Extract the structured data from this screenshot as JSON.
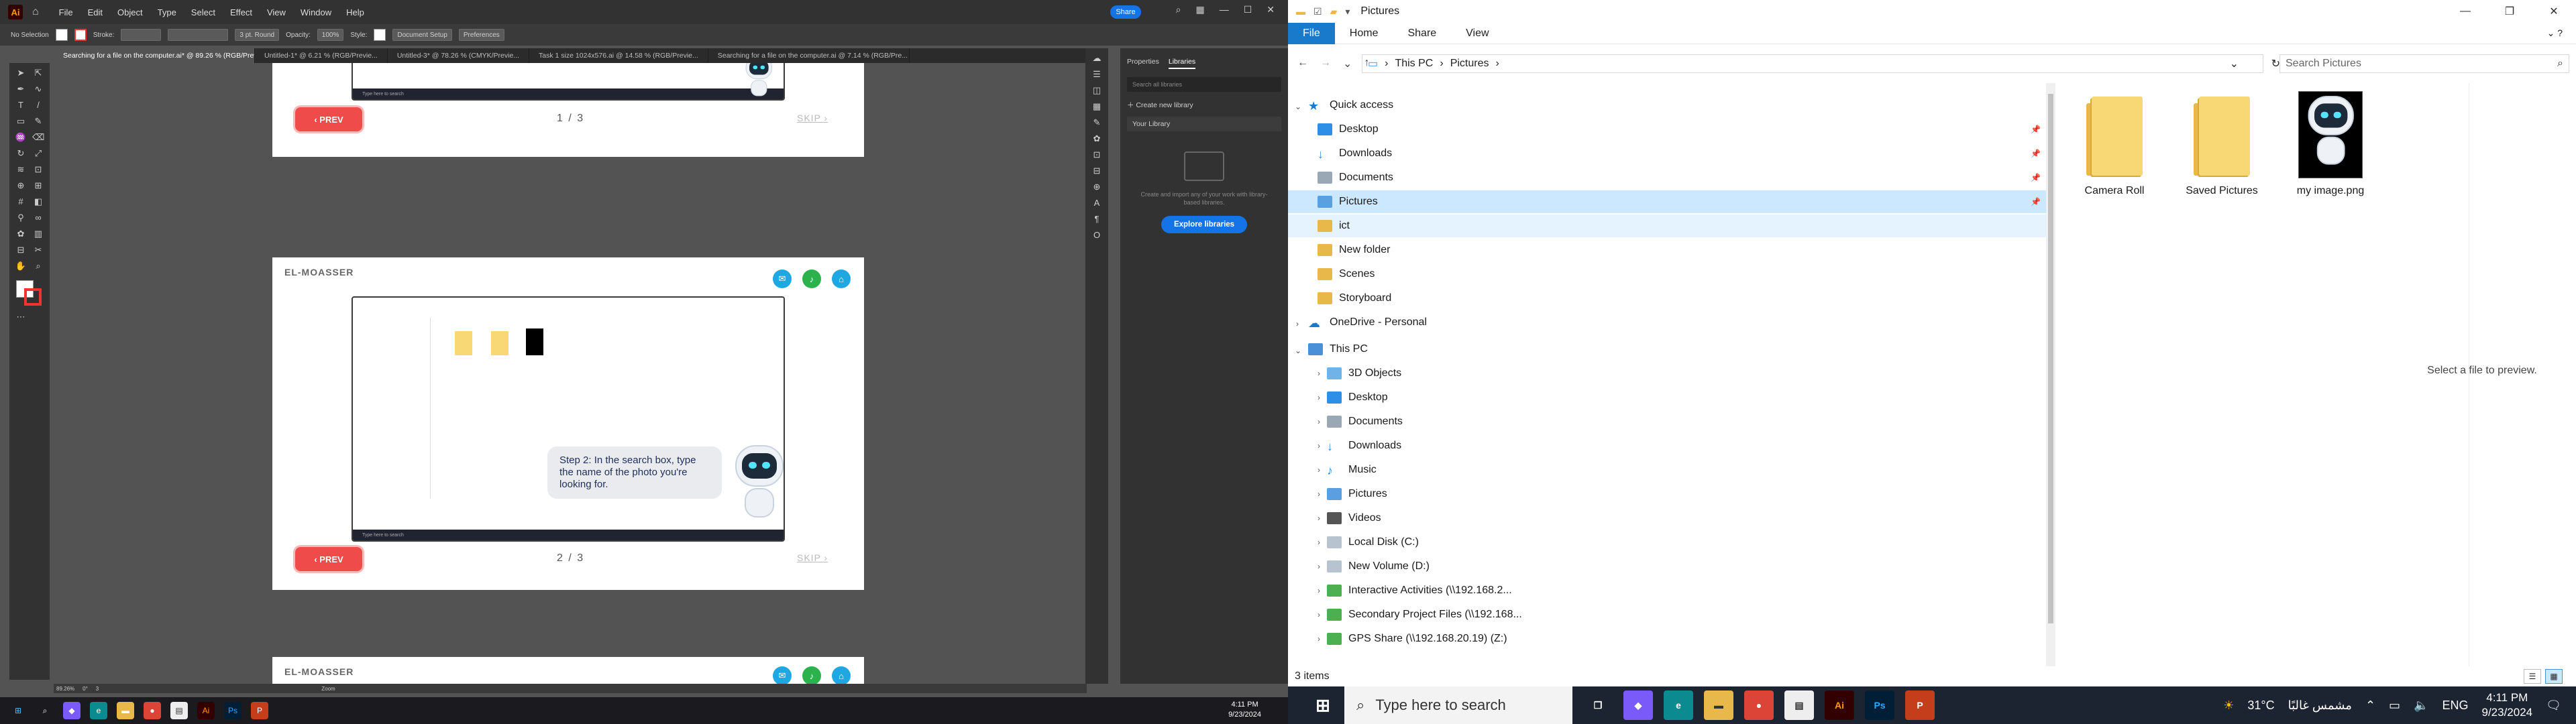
{
  "illustrator": {
    "logo": "Ai",
    "menu": [
      "File",
      "Edit",
      "Object",
      "Type",
      "Select",
      "Effect",
      "View",
      "Window",
      "Help"
    ],
    "share_label": "Share",
    "control_bar": {
      "selection": "No Selection",
      "stroke_label": "Stroke:",
      "brush": "3 pt. Round",
      "opacity_label": "Opacity:",
      "opacity_value": "100%",
      "style_label": "Style:",
      "document_setup": "Document Setup",
      "preferences": "Preferences"
    },
    "tabs": [
      "Searching for a file on the computer.ai* @ 89.26 % (RGB/Preview)",
      "Untitled-1* @ 6.21 % (RGB/Previe...",
      "Untitled-3* @ 78.26 % (CMYK/Previe...",
      "Task 1 size 1024x576.ai @ 14.58 % (RGB/Previe...",
      "Searching for a file on the computer.ai @ 7.14 % (RGB/Pre..."
    ],
    "slides": [
      {
        "prev": "‹ PREV",
        "page": "1 / 3",
        "skip": "SKIP ›"
      },
      {
        "brand": "EL-MOASSER",
        "prev": "‹ PREV",
        "page": "2 / 3",
        "skip": "SKIP ›",
        "bubble": "Step 2: In the search box, type the name of the photo you're looking for."
      },
      {
        "brand": "EL-MOASSER"
      }
    ],
    "mini_taskbar_search": "Type here to search",
    "libraries": {
      "tab_properties": "Properties",
      "tab_libraries": "Libraries",
      "search_placeholder": "Search all libraries",
      "create_new": "Create new library",
      "your_library": "Your Library",
      "empty_text": "Create and import any of your work with library-based libraries.",
      "explore_button": "Explore libraries"
    },
    "status": {
      "zoom": "89.26%",
      "angle": "0°",
      "artboard": "3",
      "tool": "Zoom"
    }
  },
  "left_taskbar": {
    "clock_time": "4:11 PM",
    "clock_date": "9/23/2024"
  },
  "explorer": {
    "title": "Pictures",
    "ribbon_tabs": [
      "File",
      "Home",
      "Share",
      "View"
    ],
    "breadcrumb": [
      "This PC",
      "Pictures"
    ],
    "search_placeholder": "Search Pictures",
    "nav": {
      "quick_access": "Quick access",
      "quick_items": [
        "Desktop",
        "Downloads",
        "Documents",
        "Pictures",
        "ict",
        "New folder",
        "Scenes",
        "Storyboard"
      ],
      "onedrive": "OneDrive - Personal",
      "this_pc": "This PC",
      "pc_items": [
        "3D Objects",
        "Desktop",
        "Documents",
        "Downloads",
        "Music",
        "Pictures",
        "Videos",
        "Local Disk (C:)",
        "New Volume (D:)",
        "Interactive Activities (\\\\192.168.2...",
        "Secondary Project Files (\\\\192.168...",
        "GPS Share (\\\\192.168.20.19) (Z:)"
      ]
    },
    "files": [
      "Camera Roll",
      "Saved Pictures",
      "my image.png"
    ],
    "preview_text": "Select a file to preview.",
    "status": "3 items"
  },
  "right_taskbar": {
    "search_placeholder": "Type here to search",
    "weather": "31°C",
    "weather_text": "مشمس غالبًا",
    "lang": "ENG",
    "clock_time": "4:11 PM",
    "clock_date": "9/23/2024"
  },
  "colors": {
    "accent_blue": "#1979ca",
    "selection": "#cce8ff",
    "folder": "#f8d775",
    "ai_bg": "#535353",
    "prev_red": "#ef4b4b"
  }
}
